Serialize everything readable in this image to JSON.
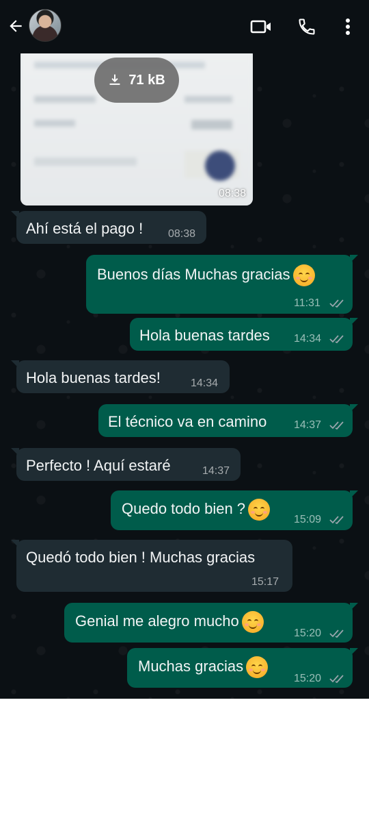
{
  "header": {
    "back_icon": "arrow-left-icon",
    "avatar_icon": "contact-avatar",
    "actions": [
      "video-call-icon",
      "phone-icon",
      "more-vert-icon"
    ]
  },
  "image_message": {
    "download_size": "71 kB",
    "time": "08:38"
  },
  "messages": [
    {
      "dir": "in",
      "text": "Ahí está el pago !",
      "time": "08:38"
    },
    {
      "dir": "out",
      "text": "Buenos días Muchas gracias",
      "emoji": true,
      "time": "11:31"
    },
    {
      "dir": "out",
      "text": "Hola buenas tardes",
      "time": "14:34"
    },
    {
      "dir": "in",
      "text": "Hola buenas tardes!",
      "time": "14:34"
    },
    {
      "dir": "out",
      "text": "El técnico va en camino",
      "time": "14:37"
    },
    {
      "dir": "in",
      "text": "Perfecto ! Aquí estaré",
      "time": "14:37"
    },
    {
      "dir": "out",
      "text": "Quedo todo bien ?",
      "emoji": true,
      "time": "15:09"
    },
    {
      "dir": "in",
      "text": "Quedó todo bien ! Muchas gracias",
      "time": "15:17"
    },
    {
      "dir": "out",
      "text": "Genial me alegro mucho",
      "emoji": true,
      "time": "15:20"
    },
    {
      "dir": "out",
      "text": "Muchas gracias",
      "emoji": true,
      "time": "15:20"
    }
  ],
  "colors": {
    "background": "#0b1014",
    "incoming": "#1f2c33",
    "outgoing": "#005c4b",
    "ticks": "#9aa6ad"
  }
}
